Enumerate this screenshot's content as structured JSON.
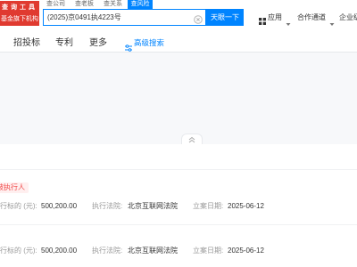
{
  "logo": {
    "line1": "查询工具",
    "line2": "基金旗下机构"
  },
  "search": {
    "tabs": [
      {
        "label": "查公司",
        "active": false
      },
      {
        "label": "查老板",
        "active": false
      },
      {
        "label": "查关系",
        "active": false
      },
      {
        "label": "查风险",
        "active": true
      }
    ],
    "value": "(2025)京0491执4223号",
    "clear_icon": "clear-circle-icon",
    "button_label": "天眼一下"
  },
  "top_nav": {
    "items": [
      {
        "label": "应用",
        "icon": "apps-grid-icon",
        "has_dropdown": true
      },
      {
        "label": "合作通道",
        "has_dropdown": true
      },
      {
        "label": "企业级"
      }
    ],
    "dropdown_icon": "caret-down-icon"
  },
  "category_nav": {
    "items": [
      {
        "label": "招投标"
      },
      {
        "label": "专利"
      },
      {
        "label": "更多"
      }
    ],
    "advanced_search": {
      "label": "高级搜索",
      "icon": "sliders-icon"
    }
  },
  "filter_panel": {
    "collapse_icon": "double-chevron-up-icon"
  },
  "results": [
    {
      "tag": "被执行人",
      "fields": [
        {
          "label": "执行标的 (元):",
          "value": "500,200.00"
        },
        {
          "label": "执行法院:",
          "value": "北京互联网法院"
        },
        {
          "label": "立案日期:",
          "value": "2025-06-12"
        }
      ]
    },
    {
      "fields": [
        {
          "label": "执行标的 (元):",
          "value": "500,200.00"
        },
        {
          "label": "执行法院:",
          "value": "北京互联网法院"
        },
        {
          "label": "立案日期:",
          "value": "2025-06-12"
        }
      ]
    }
  ],
  "colors": {
    "accent": "#0084ff",
    "brand_red": "#e03a30",
    "tag_text": "#f04848",
    "tag_background": "#ffefef",
    "label_text": "#999999",
    "value_text": "#333333"
  }
}
